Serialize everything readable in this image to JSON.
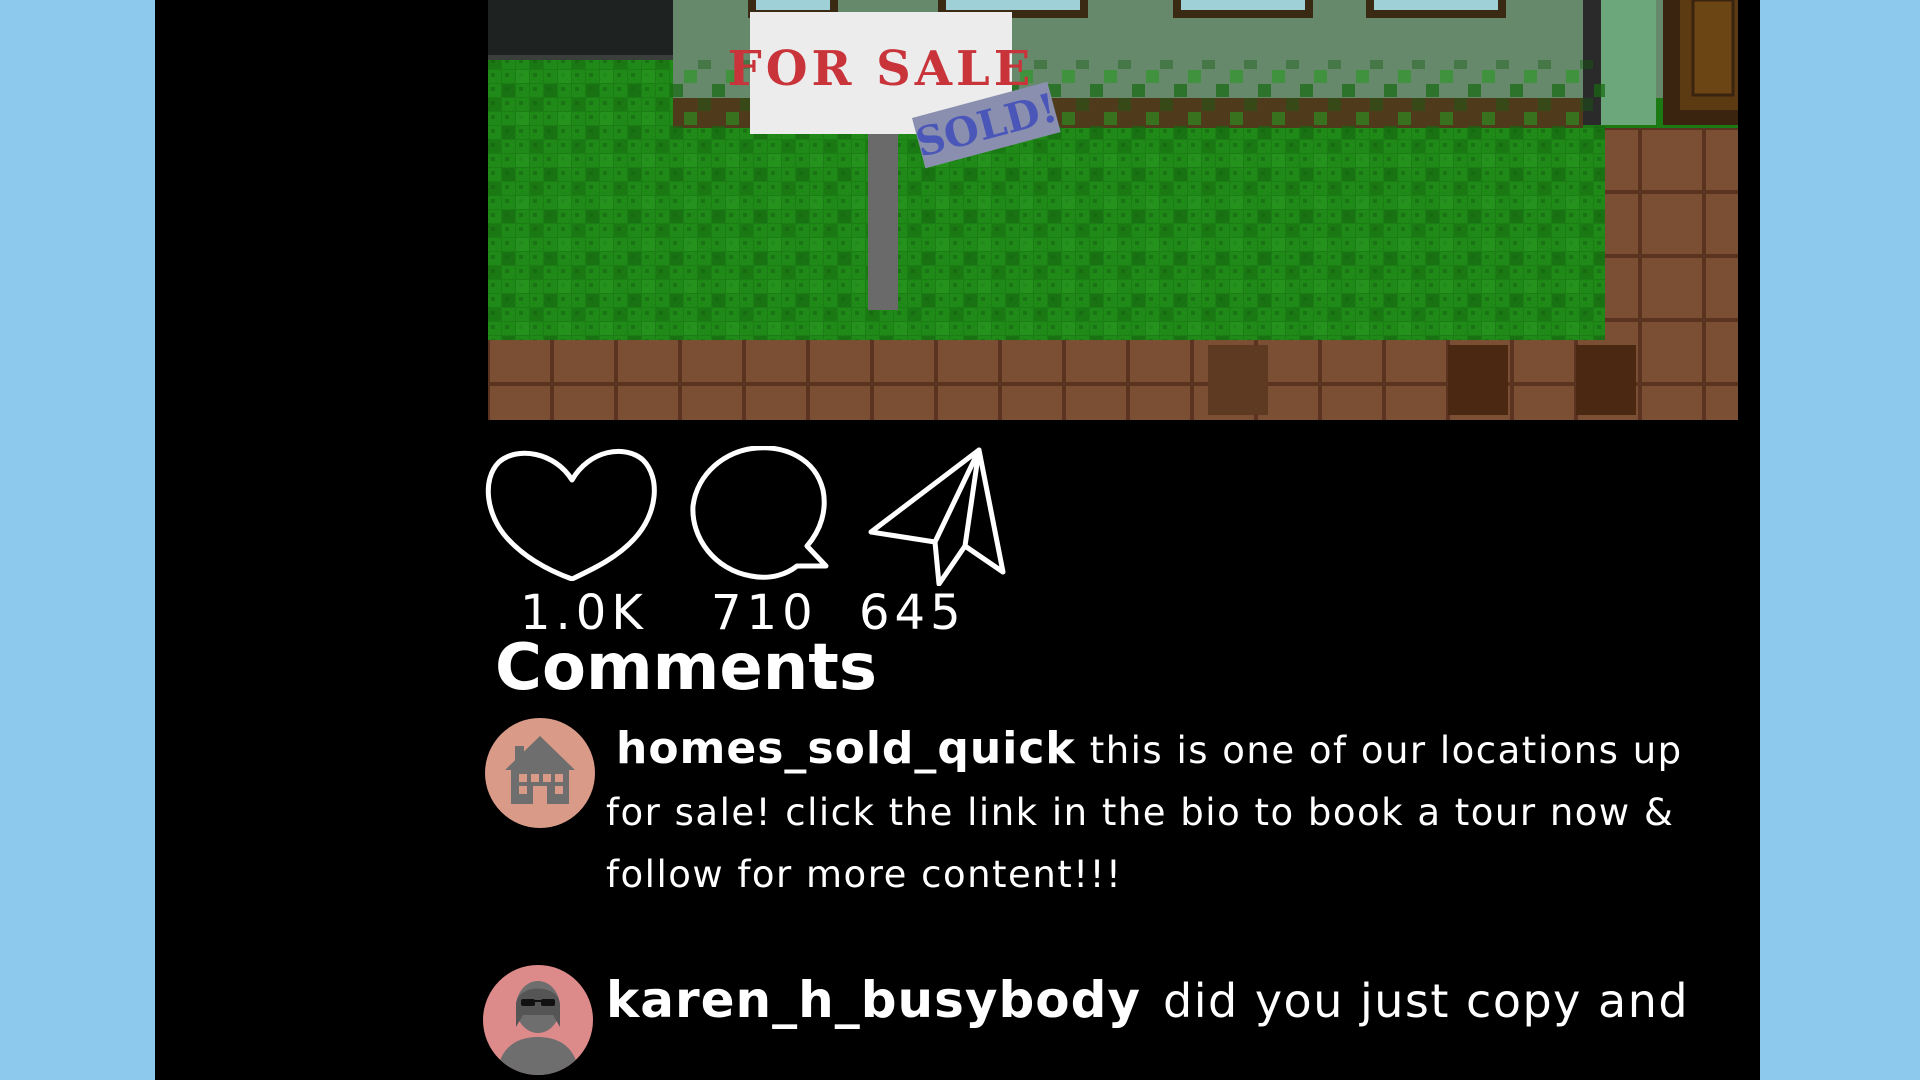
{
  "post": {
    "sign_text": "FOR SALE",
    "sold_text": "SOLD!",
    "counts": {
      "likes": "1.0K",
      "comments": "710",
      "shares": "645"
    }
  },
  "comments_section": {
    "title": "Comments",
    "items": [
      {
        "username": "homes_sold_quick",
        "text": "this is one of our locations up for sale! click the link in the bio to book a tour now & follow for more content!!!",
        "avatar_icon": "house-icon",
        "avatar_color": "#d99a87"
      },
      {
        "username": "karen_h_busybody",
        "text": "did you just copy and",
        "avatar_icon": "person-sunglasses-icon",
        "avatar_color": "#dd8a8a"
      }
    ]
  },
  "colors": {
    "background": "#8cc9ec",
    "panel": "#000000",
    "grass": "#1b7a14",
    "house_wall": "#65896a",
    "sign_red": "#c8343a",
    "sold_blue": "#4a57b8"
  }
}
